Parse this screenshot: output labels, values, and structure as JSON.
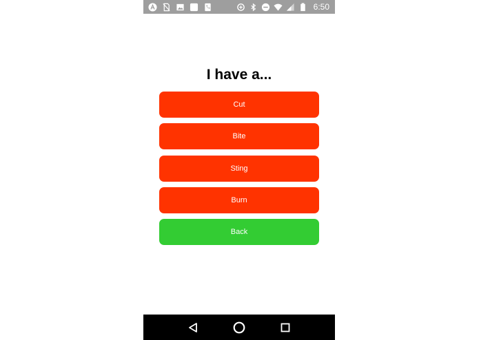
{
  "status_bar": {
    "time": "6:50",
    "left_icons": [
      "android-app-icon",
      "no-sim-card-icon",
      "image-icon",
      "square-app-icon",
      "phone-app-icon"
    ],
    "right_icons": [
      "data-saver-icon",
      "bluetooth-icon",
      "do-not-disturb-icon",
      "wifi-icon",
      "cell-signal-icon",
      "battery-icon"
    ]
  },
  "screen": {
    "title": "I have a...",
    "buttons": [
      {
        "label": "Cut",
        "color": "#ff3300"
      },
      {
        "label": "Bite",
        "color": "#ff3300"
      },
      {
        "label": "Sting",
        "color": "#ff3300"
      },
      {
        "label": "Burn",
        "color": "#ff3300"
      },
      {
        "label": "Back",
        "color": "#33cc33"
      }
    ]
  },
  "nav_bar": {
    "buttons": [
      "back-triangle-icon",
      "home-circle-icon",
      "recents-square-icon"
    ]
  },
  "colors": {
    "status_bar": "#9e9e9e",
    "danger": "#ff3300",
    "success": "#33cc33",
    "nav_bar": "#000000"
  }
}
